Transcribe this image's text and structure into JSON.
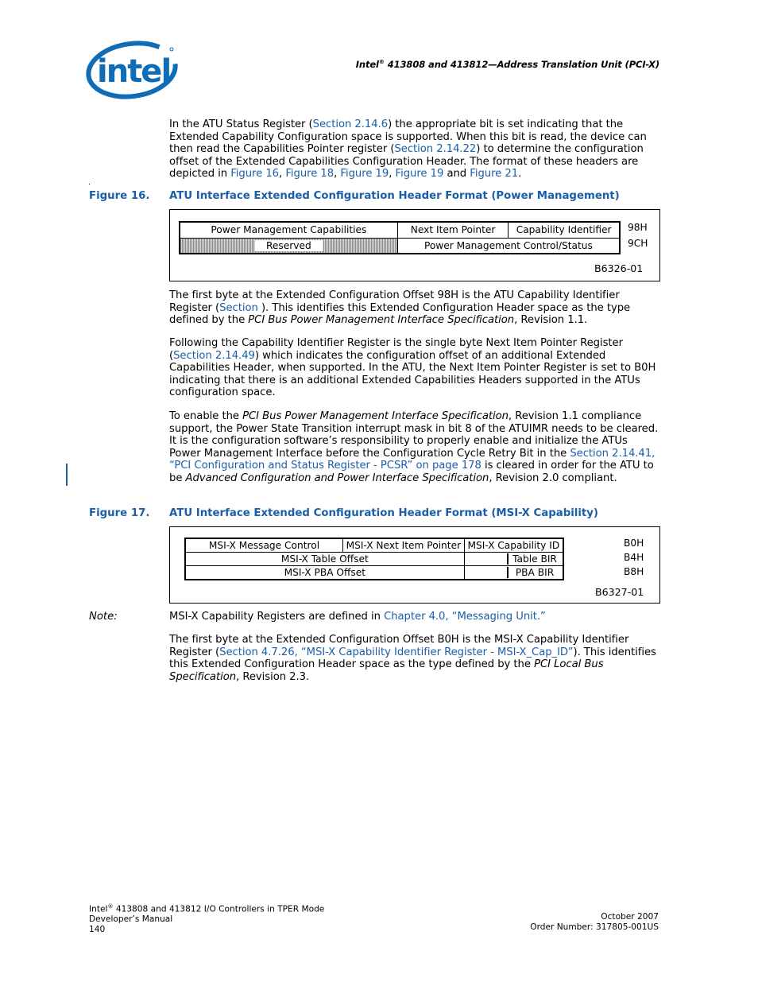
{
  "header": {
    "logo_text": "intel",
    "brand": "Intel",
    "reg_mark": "®",
    "running_title": " 413808 and 413812—Address Translation Unit (PCI-X)"
  },
  "para1": {
    "t1": "In the ATU Status Register (",
    "l1": "Section 2.14.6",
    "t2": ") the appropriate bit is set indicating that the Extended Capability Configuration space is supported. When this bit is read, the device can then read the Capabilities Pointer register (",
    "l2": "Section 2.14.22",
    "t3": ") to determine the configuration offset of the Extended Capabilities Configuration Header. The format of these headers are depicted in ",
    "l3": "Figure 16",
    "t4": ", ",
    "l4": "Figure 18",
    "t5": ", ",
    "l5": "Figure 19",
    "t6": ", ",
    "l6": "Figure 19",
    "t7": " and ",
    "l7": "Figure 21",
    "t8": "."
  },
  "figure16": {
    "number": "Figure 16.",
    "title": "ATU Interface Extended Configuration Header Format (Power Management)",
    "rows": [
      {
        "cells": [
          "Power Management Capabilities",
          "Next Item Pointer",
          "Capability Identifier"
        ],
        "offset": "98H"
      },
      {
        "cells": [
          "Reserved",
          "Power Management Control/Status"
        ],
        "offset": "9CH"
      }
    ],
    "id": "B6326-01"
  },
  "para2": {
    "t1": "The first byte at the Extended Configuration Offset 98H is the ATU Capability Identifier Register (",
    "l1": "Section ",
    "t2": "). This identifies this Extended Configuration Header space as the type defined by the ",
    "i1": "PCI Bus Power Management Interface Specification",
    "t3": ", Revision 1.1."
  },
  "para3": {
    "t1": "Following the Capability Identifier Register is the single byte Next Item Pointer Register (",
    "l1": "Section 2.14.49",
    "t2": ") which indicates the configuration offset of an additional Extended Capabilities Header, when supported. In the ATU, the Next Item Pointer Register is set to B0H indicating that there is an additional Extended Capabilities Headers supported in the ATUs configuration space."
  },
  "para4": {
    "t1": "To enable the ",
    "i1": "PCI Bus Power Management Interface Specification",
    "t2": ", Revision 1.1 compliance support, the Power State Transition interrupt mask in bit 8 of the ATUIMR needs to be cleared. It is the configuration software’s responsibility to properly enable and initialize the ATUs Power Management Interface before the Configuration Cycle Retry Bit in the ",
    "l1": "Section 2.14.41, “PCI Configuration and Status Register - PCSR” on page 178",
    "t3": " is cleared in order for the ATU to be ",
    "i2": "Advanced Configuration and Power Interface Specification",
    "t4": ", Revision 2.0 compliant."
  },
  "figure17": {
    "number": "Figure 17.",
    "title": "ATU Interface Extended Configuration Header Format (MSI-X Capability)",
    "rows": [
      {
        "cells": [
          "MSI-X Message Control",
          "MSI-X Next Item Pointer",
          "MSI-X Capability ID"
        ],
        "offset": "B0H"
      },
      {
        "cells": [
          "MSI-X Table Offset",
          "Table BIR"
        ],
        "offset": "B4H"
      },
      {
        "cells": [
          "MSI-X PBA Offset",
          "PBA BIR"
        ],
        "offset": "B8H"
      }
    ],
    "id": "B6327-01"
  },
  "note": {
    "label": "Note:",
    "t1": "MSI-X Capability Registers are defined in ",
    "l1": "Chapter 4.0, “Messaging Unit.”"
  },
  "para5": {
    "t1": "The first byte at the Extended Configuration Offset B0H is the MSI-X Capability Identifier Register (",
    "l1": "Section 4.7.26, “MSI-X Capability Identifier Register - MSI-X_Cap_ID”",
    "t2": "). This identifies this Extended Configuration Header space as the type defined by the ",
    "i1": "PCI Local Bus Specification",
    "t3": ", Revision 2.3."
  },
  "footer": {
    "brand": "Intel",
    "reg_mark": "®",
    "doc_title": " 413808 and 413812 I/O Controllers in TPER Mode",
    "doc_type": "Developer’s Manual",
    "page_number": "140",
    "date": "October 2007",
    "order_number": "Order Number: 317805-001US"
  },
  "colors": {
    "link": "#1a5ea8",
    "logo": "#0f6cb6"
  }
}
